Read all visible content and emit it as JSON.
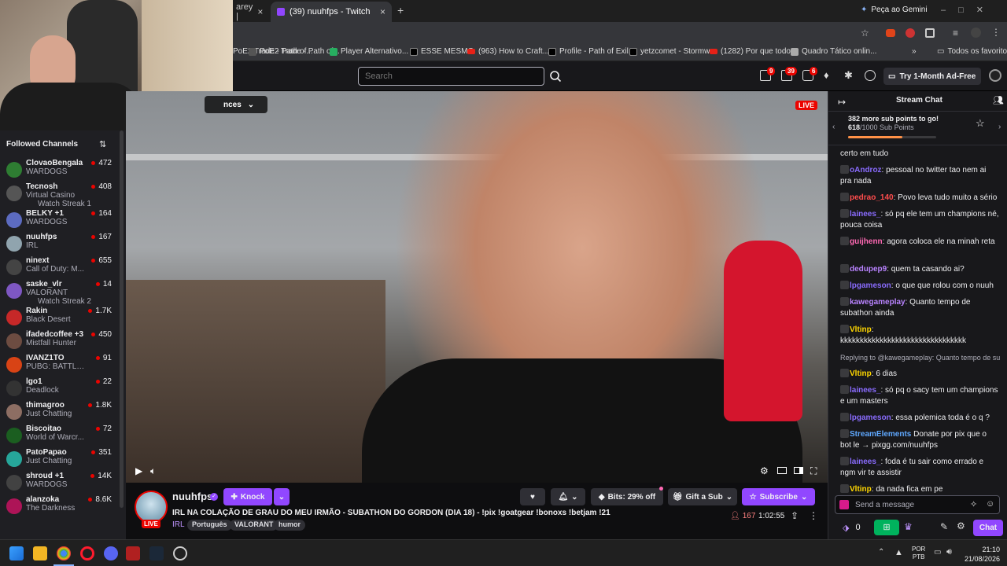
{
  "browser": {
    "tabs": [
      {
        "label": "arey |",
        "active": false
      },
      {
        "label": "(39) nuuhfps - Twitch",
        "active": true
      }
    ],
    "new_tab": "+",
    "gemini": "Peça ao Gemini",
    "bookmarks": [
      "PoE2 Trade - Path of...",
      "Player Alternativo...",
      "ESSE MESMO",
      "(963) How to Craft...",
      "Profile - Path of Exil...",
      "yetzcomet - Stormw...",
      "(1282) Por que todo...",
      "Quadro Tático onlin..."
    ],
    "all_favorites": "Todos os favoritos",
    "overflow": "»"
  },
  "twitch_nav": {
    "search_placeholder": "Search",
    "badges": {
      "inbox": "9",
      "whispers": "39",
      "notifications": "6"
    },
    "ad_free": "Try 1-Month Ad-Free"
  },
  "sidebar": {
    "title": "Followed Channels",
    "channels": [
      {
        "name": "ClovaoBengala",
        "game": "WARDOGS",
        "viewers": "472",
        "color": "#2e7d32"
      },
      {
        "name": "Tecnosh",
        "game": "Virtual Casino",
        "extra": "Watch Streak 1",
        "viewers": "408",
        "color": "#555"
      },
      {
        "name": "BELKY +1",
        "game": "WARDOGS",
        "viewers": "164",
        "color": "#5c6bc0"
      },
      {
        "name": "nuuhfps",
        "game": "IRL",
        "viewers": "167",
        "color": "#90a4ae"
      },
      {
        "name": "ninext",
        "game": "Call of Duty: M...",
        "viewers": "655",
        "color": "#444"
      },
      {
        "name": "saske_vlr",
        "game": "VALORANT",
        "extra": "Watch Streak 2",
        "viewers": "14",
        "color": "#7e57c2"
      },
      {
        "name": "Rakin",
        "game": "Black Desert",
        "viewers": "1.7K",
        "color": "#c62828"
      },
      {
        "name": "ifadedcoffee +3",
        "game": "Mistfall Hunter",
        "viewers": "450",
        "color": "#6d4c41"
      },
      {
        "name": "IVANZ1TO",
        "game": "PUBG: BATTLE...",
        "viewers": "91",
        "color": "#d84315"
      },
      {
        "name": "lgo1",
        "game": "Deadlock",
        "viewers": "22",
        "color": "#333"
      },
      {
        "name": "thimagroo",
        "game": "Just Chatting",
        "viewers": "1.8K",
        "color": "#8d6e63"
      },
      {
        "name": "Biscoitao",
        "game": "World of Warcr...",
        "viewers": "72",
        "color": "#1b5e20"
      },
      {
        "name": "PatoPapao",
        "game": "Just Chatting",
        "viewers": "351",
        "color": "#26a69a"
      },
      {
        "name": "shroud +1",
        "game": "WARDOGS",
        "viewers": "14K",
        "color": "#424242"
      },
      {
        "name": "alanzoka",
        "game": "The Darkness",
        "viewers": "8.6K",
        "color": "#ad1457"
      }
    ]
  },
  "video": {
    "live": "LIVE",
    "overlay_label": "nces"
  },
  "stream": {
    "channel": "nuuhfps",
    "knock": "Knock",
    "bits": "Bits: 29% off",
    "gift": "Gift a Sub",
    "subscribe": "Subscribe",
    "title": "IRL NA COLAÇÃO DE GRAU DO MEU IRMÃO - SUBATHON DO GORDON (DIA 18) - !pix !goatgear !bonoxs !betjam !21",
    "category": "IRL",
    "tags": [
      "Português",
      "VALORANT",
      "humor"
    ],
    "viewers": "167",
    "uptime": "1:02:55",
    "live": "LIVE"
  },
  "chat": {
    "title": "Stream Chat",
    "sub_goal_title": "382 more sub points to go!",
    "sub_points_current": "618",
    "sub_points_label": "/1000 Sub Points",
    "sub_progress": 0.618,
    "messages": [
      {
        "user": "",
        "color": "#efeff1",
        "text": "certo em tudo"
      },
      {
        "user": "oAndroz",
        "color": "#8a6cff",
        "text": ": pessoal no twitter tao nem ai pra nada"
      },
      {
        "user": "pedrao_140",
        "color": "#ff4d4d",
        "text": ": Povo leva tudo muito a sério"
      },
      {
        "user": "lainees_",
        "color": "#8a6cff",
        "text": ": só pq ele tem um champions né, pouca coisa"
      },
      {
        "user": "guijhenn",
        "color": "#ff69b4",
        "text": ": agora coloca ele na minah reta"
      },
      {
        "user": "dedupep9",
        "color": "#b983ff",
        "text": ": quem ta casando ai?"
      },
      {
        "user": "lpgameson",
        "color": "#8a6cff",
        "text": ": o que que rolou com o nuuh"
      },
      {
        "user": "kawegameplay",
        "color": "#b983ff",
        "text": ": Quanto tempo de subathon ainda"
      },
      {
        "user": "Vltinp",
        "color": "#ffd700",
        "text": ": kkkkkkkkkkkkkkkkkkkkkkkkkkkkkkkk"
      },
      {
        "user": "",
        "color": "#adadb8",
        "text": "Replying to @kawegameplay: Quanto tempo de su"
      },
      {
        "user": "Vltinp",
        "color": "#ffd700",
        "text": ": 6 dias"
      },
      {
        "user": "lainees_",
        "color": "#8a6cff",
        "text": ": só pq o sacy tem um champions e um masters"
      },
      {
        "user": "lpgameson",
        "color": "#8a6cff",
        "text": ": essa polemica toda é o q ?"
      },
      {
        "user": "StreamElements",
        "color": "#5fa8ff",
        "text": " Donate por pix que o bot le → pixgg.com/nuuhfps"
      },
      {
        "user": "lainees_",
        "color": "#8a6cff",
        "text": ": foda é tu sair como errado e ngm vir te assistir"
      },
      {
        "user": "Vltinp",
        "color": "#ffd700",
        "text": ": da nada fica em pe"
      }
    ],
    "input_placeholder": "Send a message",
    "points": "0",
    "chat_button": "Chat"
  },
  "taskbar": {
    "lang": "POR",
    "layout": "PTB",
    "time": "21:10",
    "date": "21/08/2026"
  }
}
